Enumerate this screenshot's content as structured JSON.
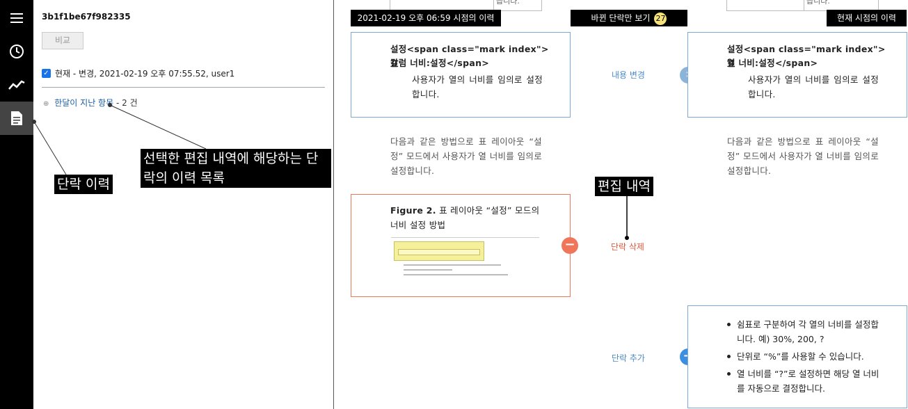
{
  "revision_id": "3b1f1be67f982335",
  "compare_label": "비교",
  "current_entry": "현재 - 변경, 2021-02-19 오후 07:55.52, user1",
  "older": {
    "link": "한달이 지난 항목",
    "count": "- 2 건"
  },
  "callouts": {
    "paragraph_history": "단락 이력",
    "edit_list": "선택한 편집 내역에 해당하는 단락의 이력 목록",
    "edit_history": "편집 내역"
  },
  "headers": {
    "left": "2021-02-19 오후 06:59 시점의 이력",
    "middle": "바뀐 단락만 보기",
    "middle_count": "27",
    "right": "현재 시점의 이력"
  },
  "stub_text": "습니다.",
  "left_box1": {
    "line1": "설정<span class=\"mark index\">표",
    "line2": "칼럼 너비:설정</span>",
    "body": "사용자가 열의 너비를 임의로 설정합니다."
  },
  "right_box1": {
    "line1": "설정<span class=\"mark index\">표",
    "line2": "열 너비:설정</span>",
    "body": "사용자가 열의 너비를 임의로 설정합니다."
  },
  "paragraph2": "다음과 같은 방법으로 표 레이아웃 “설정” 모드에서 사용자가 열 너비를 임의로 설정합니다.",
  "figure": {
    "title_bold": "Figure 2.",
    "title_rest": " 표 레이아웃 “설정” 모드의 너비 설정 방법"
  },
  "changes": {
    "modified": "내용 변경",
    "deleted": "단락 삭제",
    "added": "단락 추가"
  },
  "bullets": [
    "쉼표로 구분하여 각 열의 너비를 설정합니다. 예) 30%, 200, ?",
    "단위로 “%”를 사용할 수 있습니다.",
    "열 너비를 “?”로 설정하면 해당 열 너비를 자동으로 결정합니다."
  ],
  "icons": [
    "menu-icon",
    "clock-icon",
    "chart-icon",
    "document-icon",
    "chevron-right-icon",
    "minus-icon",
    "plus-icon"
  ],
  "colors": {
    "modified": "#8ab4d8",
    "deleted": "#f0765a",
    "added": "#3d8ee0",
    "badge": "#f7e27a"
  }
}
